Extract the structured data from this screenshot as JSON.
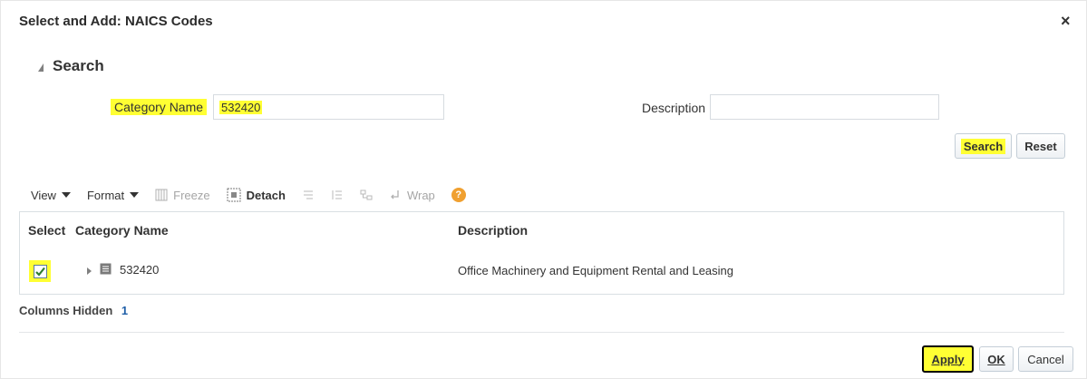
{
  "dialog": {
    "title": "Select and Add: NAICS Codes",
    "close_label": "×"
  },
  "search": {
    "header": "Search",
    "category_name_label": "Category Name",
    "category_name_value": "532420",
    "description_label": "Description",
    "description_value": "",
    "search_button": "Search",
    "reset_button": "Reset"
  },
  "toolbar": {
    "view": "View",
    "format": "Format",
    "freeze": "Freeze",
    "detach": "Detach",
    "wrap": "Wrap",
    "help_glyph": "?"
  },
  "table": {
    "columns": [
      "Select",
      "Category Name",
      "Description"
    ],
    "rows": [
      {
        "selected": true,
        "category_name": "532420",
        "description": "Office Machinery and Equipment Rental and Leasing"
      }
    ]
  },
  "footer": {
    "columns_hidden_label": "Columns Hidden",
    "columns_hidden_count": "1",
    "apply_button": "Apply",
    "ok_button": "OK",
    "cancel_button": "Cancel"
  },
  "colors": {
    "highlight": "#ffff33",
    "help_icon": "#f0a030",
    "checkmark": "#2e7d32"
  }
}
